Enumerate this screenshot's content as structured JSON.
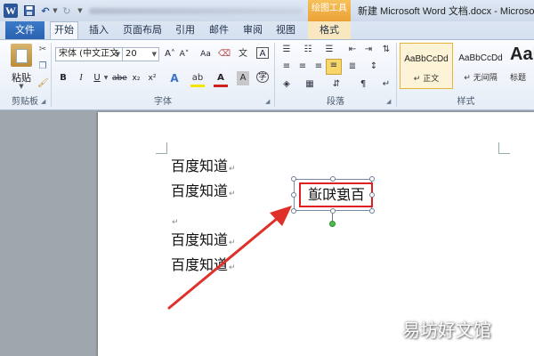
{
  "titlebar": {
    "app_icon": "W",
    "drawing_tools_tab": "绘图工具",
    "document_title": "新建 Microsoft Word 文档.docx - Microso"
  },
  "tabs": {
    "file": "文件",
    "home": "开始",
    "insert": "插入",
    "page_layout": "页面布局",
    "references": "引用",
    "mailings": "邮件",
    "review": "审阅",
    "view": "视图",
    "format": "格式"
  },
  "ribbon": {
    "clipboard": {
      "paste_label": "粘贴",
      "group_label": "剪贴板"
    },
    "font": {
      "font_name": "宋体 (中文正文",
      "font_size": "20",
      "group_label": "字体",
      "glyphs": {
        "grow": "A˄",
        "shrink": "A˅",
        "change_case": "Aa",
        "bold": "B",
        "italic": "I",
        "underline": "U",
        "strike": "abe",
        "subscript": "x₂",
        "superscript": "x²",
        "text_effects": "A",
        "highlight": "ab",
        "font_color": "A",
        "char_shading": "A",
        "enclose_char": "字",
        "phonetic": "文",
        "char_border": "A"
      }
    },
    "paragraph": {
      "group_label": "段落"
    },
    "styles": {
      "group_label": "样式",
      "items": [
        {
          "preview": "AaBbCcDd",
          "name": "↵ 正文"
        },
        {
          "preview": "AaBbCcDd",
          "name": "↵ 无间隔"
        },
        {
          "preview": "AaI",
          "name": "标题"
        }
      ]
    }
  },
  "document": {
    "lines": [
      "百度知道",
      "百度知道",
      "",
      "百度知道",
      "百度知道"
    ],
    "paragraph_mark": "↵",
    "textbox_text": "百度知道"
  },
  "watermark": "易坊好文馆",
  "colors": {
    "accent_blue": "#2b579a",
    "drawing_tools": "#eaa236",
    "highlight_red": "#e02020",
    "rotate_handle": "#4bbf4b"
  }
}
